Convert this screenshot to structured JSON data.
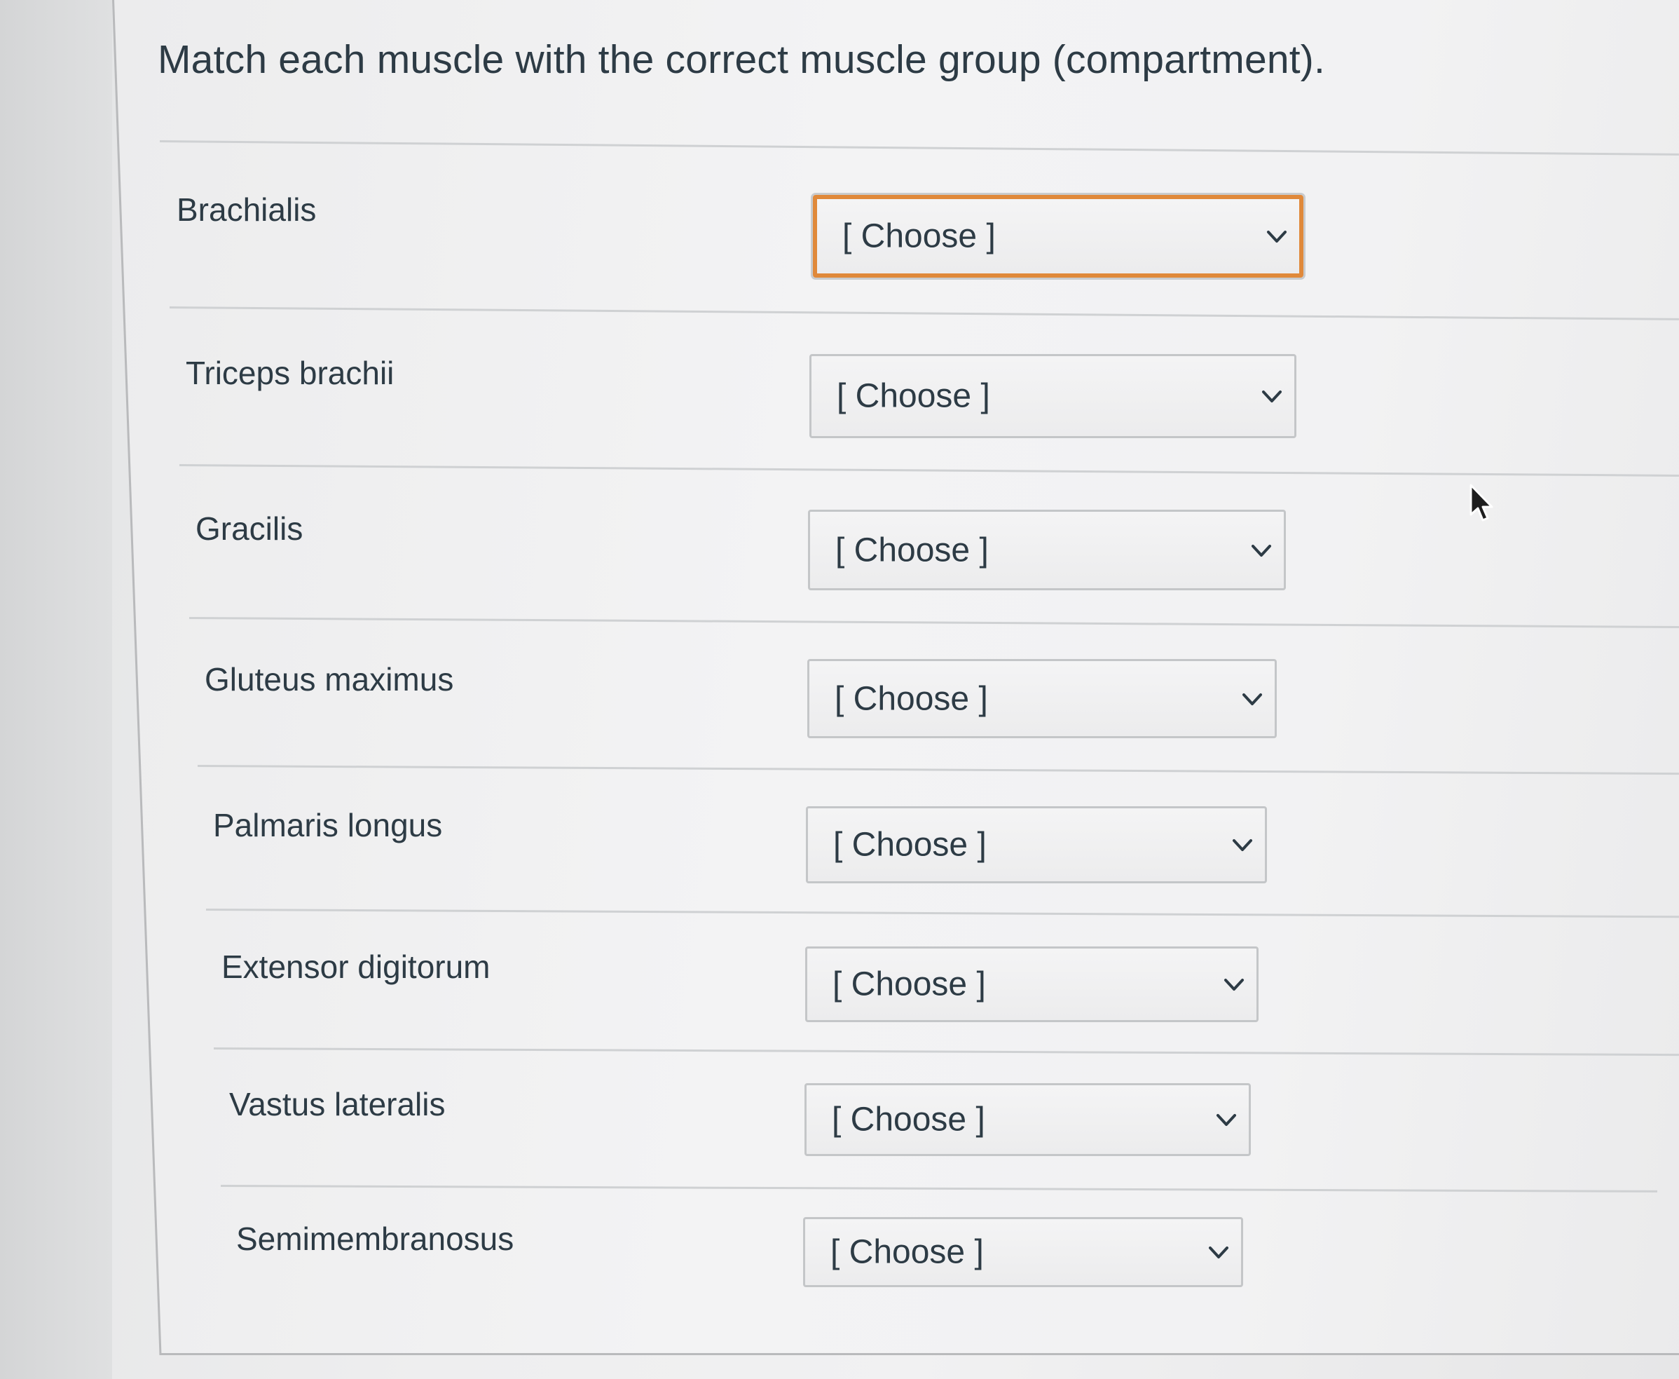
{
  "question": {
    "prompt": "Match each muscle with the correct muscle group (compartment)."
  },
  "matches": [
    {
      "label": "Brachialis",
      "selected": "[ Choose ]"
    },
    {
      "label": "Triceps brachii",
      "selected": "[ Choose ]"
    },
    {
      "label": "Gracilis",
      "selected": "[ Choose ]"
    },
    {
      "label": "Gluteus maximus",
      "selected": "[ Choose ]"
    },
    {
      "label": "Palmaris longus",
      "selected": "[ Choose ]"
    },
    {
      "label": "Extensor digitorum",
      "selected": "[ Choose ]"
    },
    {
      "label": "Vastus lateralis",
      "selected": "[ Choose ]"
    },
    {
      "label": "Semimembranosus",
      "selected": "[ Choose ]"
    }
  ],
  "icons": {
    "dropdown": "chevron-down-icon",
    "pointer": "mouse-cursor-icon"
  },
  "colors": {
    "text": "#2d3b45",
    "focus_ring": "#e0893a",
    "border": "#c4c6c8"
  }
}
